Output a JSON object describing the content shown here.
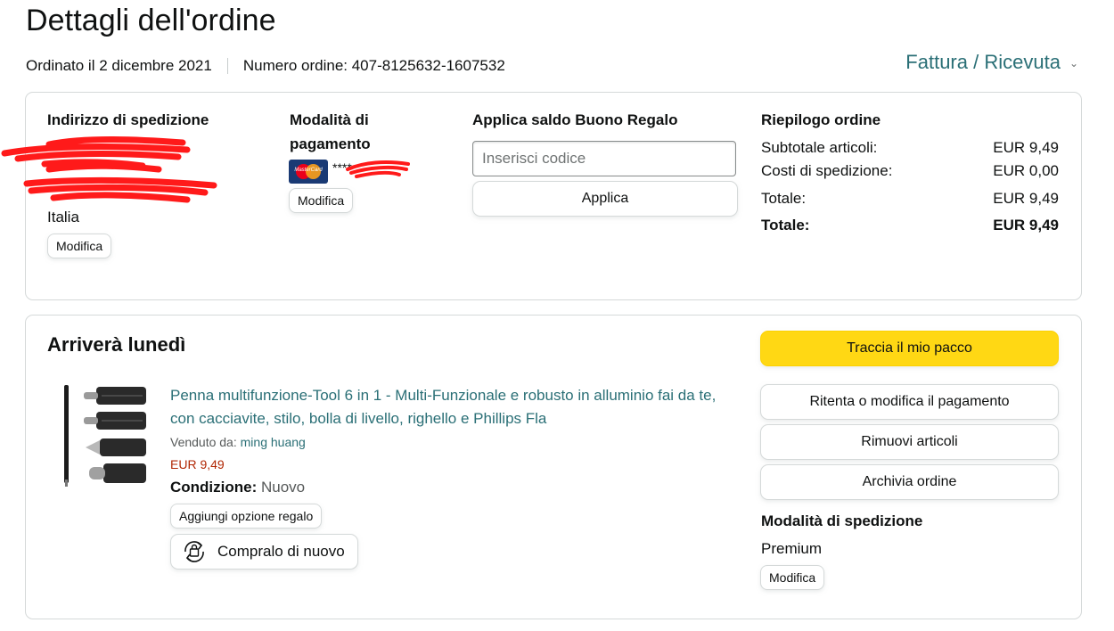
{
  "header": {
    "title": "Dettagli dell'ordine",
    "order_date": "Ordinato il 2 dicembre 2021",
    "order_number": "Numero ordine: 407-8125632-1607532",
    "invoice_link": "Fattura / Ricevuta"
  },
  "shipping_address": {
    "heading": "Indirizzo di spedizione",
    "country": "Italia",
    "edit_label": "Modifica"
  },
  "payment": {
    "heading_line1": "Modalità di",
    "heading_line2": "pagamento",
    "card_brand": "MasterCard",
    "card_mask": "****",
    "edit_label": "Modifica"
  },
  "gift_card": {
    "heading": "Applica saldo Buono Regalo",
    "placeholder": "Inserisci codice",
    "apply_label": "Applica"
  },
  "summary": {
    "heading": "Riepilogo ordine",
    "rows": [
      {
        "label": "Subtotale articoli:",
        "value": "EUR 9,49"
      },
      {
        "label": "Costi di spedizione:",
        "value": "EUR 0,00"
      },
      {
        "label": "Totale:",
        "value": "EUR 9,49"
      },
      {
        "label": "Totale:",
        "value": "EUR 9,49"
      }
    ]
  },
  "shipment": {
    "arrival": "Arriverà lunedì",
    "product_title": "Penna multifunzione-Tool 6 in 1 - Multi-Funzionale e robusto in alluminio fai da te, con cacciavite, stilo, bolla di livello, righello e Phillips Fla",
    "seller_label": "Venduto da:",
    "seller_name": "ming huang",
    "price": "EUR 9,49",
    "condition_label": "Condizione:",
    "condition_value": "Nuovo",
    "gift_option": "Aggiungi opzione regalo",
    "buy_again": "Compralo di nuovo",
    "actions": {
      "track": "Traccia il mio pacco",
      "retry_payment": "Ritenta o modifica il pagamento",
      "remove_items": "Rimuovi articoli",
      "archive": "Archivia ordine"
    },
    "shipping_method_heading": "Modalità di spedizione",
    "shipping_method": "Premium",
    "edit_label": "Modifica"
  },
  "colors": {
    "link": "#2a6f76",
    "price": "#b12704",
    "primary_button": "#ffd814",
    "border": "#d5d9d9",
    "redaction": "#ff1a1a"
  }
}
